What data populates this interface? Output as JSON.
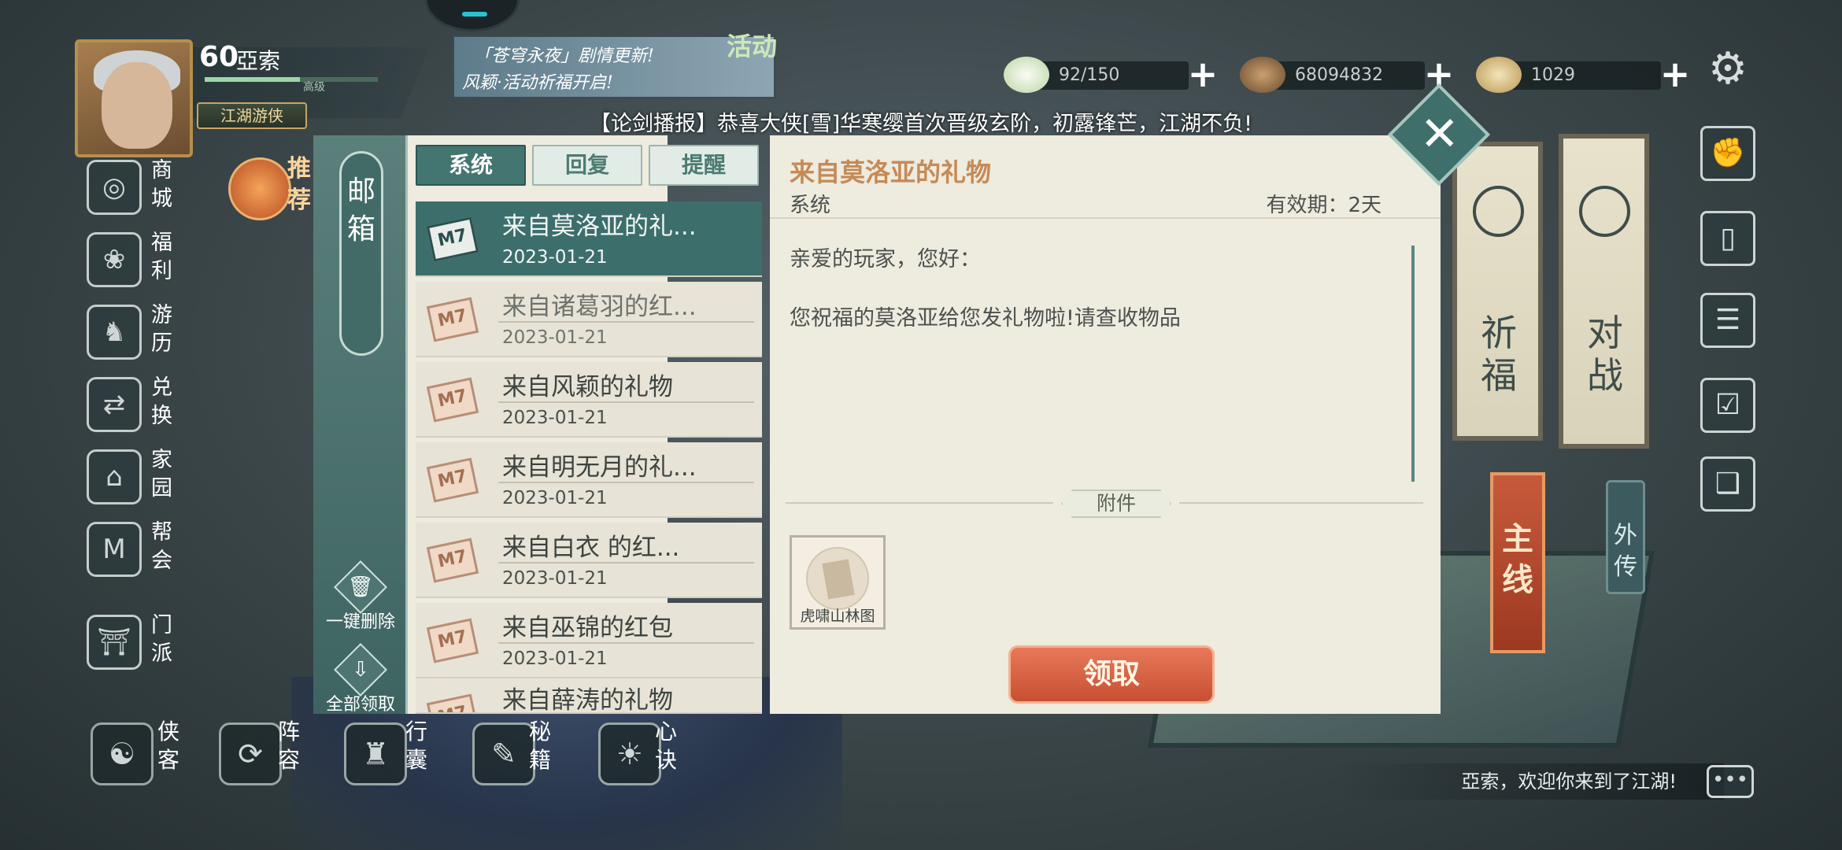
{
  "player": {
    "level": "60",
    "name": "亞索",
    "title": "江湖游侠",
    "exp_label": "高级",
    "exp_fraction": 0.55
  },
  "banner": {
    "line1": "「苍穹永夜」剧情更新!",
    "line2": "风颖·活动祈福开启!",
    "event_label": "活动"
  },
  "resources": [
    {
      "icon": "steamed-bun-icon",
      "value": "92/150"
    },
    {
      "icon": "coins-icon",
      "value": "68094832"
    },
    {
      "icon": "ingot-icon",
      "value": "1029"
    }
  ],
  "broadcast": "【论剑播报】恭喜大侠[雪]华寒缨首次晋级玄阶，初露锋芒，江湖不负!",
  "left_nav": [
    {
      "label": "商城",
      "icon": "shop-icon"
    },
    {
      "label": "福利",
      "icon": "welfare-icon"
    },
    {
      "label": "游历",
      "icon": "travel-horse-icon"
    },
    {
      "label": "兑换",
      "icon": "exchange-icon"
    },
    {
      "label": "家园",
      "icon": "home-icon"
    },
    {
      "label": "帮会",
      "icon": "guild-icon"
    },
    {
      "label": "门派",
      "icon": "sect-icon"
    }
  ],
  "recommend_label": "推荐",
  "bottom_nav": [
    {
      "label": "侠客",
      "icon": "hero-icon"
    },
    {
      "label": "阵容",
      "icon": "formation-icon"
    },
    {
      "label": "行囊",
      "icon": "bag-icon"
    },
    {
      "label": "秘籍",
      "icon": "manual-icon"
    },
    {
      "label": "心诀",
      "icon": "heart-skill-icon"
    }
  ],
  "right_side": {
    "pray": "祈福",
    "battle": "对战",
    "main_quest": "主线",
    "side_story": "外传"
  },
  "chat": {
    "message": "亞索，欢迎你来到了江湖!"
  },
  "mailbox": {
    "title": "邮箱",
    "tabs": [
      "系统",
      "回复",
      "提醒"
    ],
    "active_tab": 0,
    "actions": {
      "delete_all": "一键删除",
      "claim_all": "全部领取"
    },
    "mails": [
      {
        "title": "来自莫洛亚的礼...",
        "date": "2023-01-21",
        "selected": true
      },
      {
        "title": "来自诸葛羽的红...",
        "date": "2023-01-21"
      },
      {
        "title": "来自风颖的礼物",
        "date": "2023-01-21"
      },
      {
        "title": "来自明无月的礼...",
        "date": "2023-01-21"
      },
      {
        "title": "来自白衣 的红...",
        "date": "2023-01-21"
      },
      {
        "title": "来自巫锦的红包",
        "date": "2023-01-21"
      },
      {
        "title": "来自薛涛的礼物",
        "date": ""
      }
    ],
    "detail": {
      "title": "来自莫洛亚的礼物",
      "sender": "系统",
      "validity": "有效期：2天",
      "greeting": "亲爱的玩家，您好：",
      "body": "您祝福的莫洛亚给您发礼物啦!请查收物品",
      "attachment_label": "附件",
      "attachments": [
        {
          "name": "虎啸山林图"
        }
      ],
      "claim_button": "领取"
    }
  }
}
